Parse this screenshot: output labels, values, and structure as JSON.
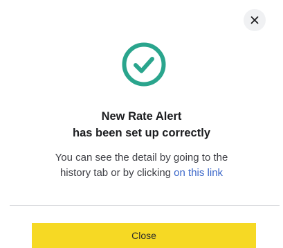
{
  "dialog": {
    "title_line1": "New Rate Alert",
    "title_line2": "has been set up correctly",
    "description_line1": "You can see the detail by going to the",
    "description_line2_prefix": "history tab or by clicking ",
    "description_link": "on this link",
    "close_button_label": "Close",
    "close_icon": "close-icon",
    "status_icon": "check-circle-icon"
  },
  "colors": {
    "success": "#2aa58d",
    "link": "#3b67c9",
    "button": "#f6d924",
    "close_icon_bg": "#f0f1f3"
  }
}
